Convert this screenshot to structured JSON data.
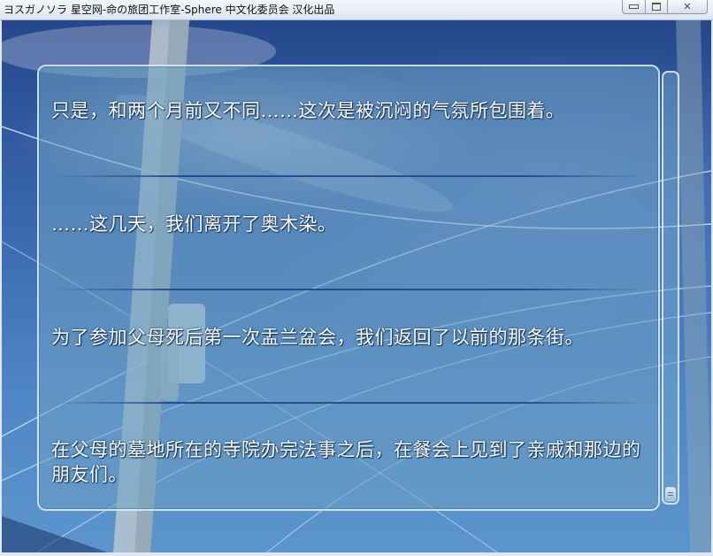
{
  "window": {
    "title": "ヨスガノソラ 星空网-命の旅团工作室-Sphere 中文化委员会 汉化出品",
    "minimize_icon": "minimize-icon",
    "maximize_icon": "maximize-icon",
    "close_icon": "close-icon",
    "close_glyph": "✕"
  },
  "backlog": {
    "lines": [
      "只是，和两个月前又不同……这次是被沉闷的气氛所包围着。",
      "……这几天，我们离开了奥木染。",
      "为了参加父母死后第一次盂兰盆会，我们返回了以前的那条街。",
      "在父母的墓地所在的寺院办完法事之后，在餐会上见到了亲戚和那边的朋友们。"
    ],
    "scroll_position": 1.0
  },
  "colors": {
    "text": "#ffffff",
    "text_outline": "#0e2f57",
    "panel": "#6ea0c3",
    "frame": "#e1eef8"
  }
}
